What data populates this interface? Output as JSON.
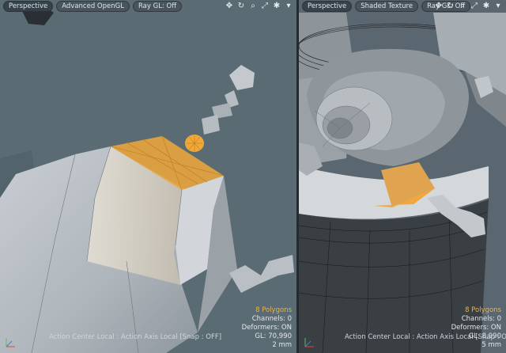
{
  "left_viewport": {
    "tabs": [
      "Perspective",
      "Advanced OpenGL",
      "Ray GL: Off"
    ],
    "tools": [
      "move-view-icon",
      "rotate-view-icon",
      "zoom-view-icon",
      "fit-view-icon",
      "settings-icon",
      "expand-icon"
    ],
    "stats": {
      "polygons": "8 Polygons",
      "channels": "Channels: 0",
      "deformers": "Deformers: ON",
      "gl": "GL: 70,990",
      "scale": "2 mm"
    },
    "action_center": "Action Center Local : Action Axis Local  [Snap : OFF]"
  },
  "right_viewport": {
    "tabs": [
      "Perspective",
      "Shaded Texture",
      "Ray GL: Off"
    ],
    "tools": [
      "move-view-icon",
      "rotate-view-icon",
      "zoom-view-icon",
      "fit-view-icon",
      "settings-icon",
      "expand-icon"
    ],
    "stats": {
      "polygons": "8 Polygons",
      "channels": "Channels: 0",
      "deformers": "Deformers: ON",
      "gl": "GL: 8,990",
      "scale": "5 mm"
    },
    "action_center": "Action Center Local : Action Axis Local  [Snap : OFF]"
  },
  "colors": {
    "selection": "#f0a83a",
    "viewport_bg": "#5b6b73"
  }
}
